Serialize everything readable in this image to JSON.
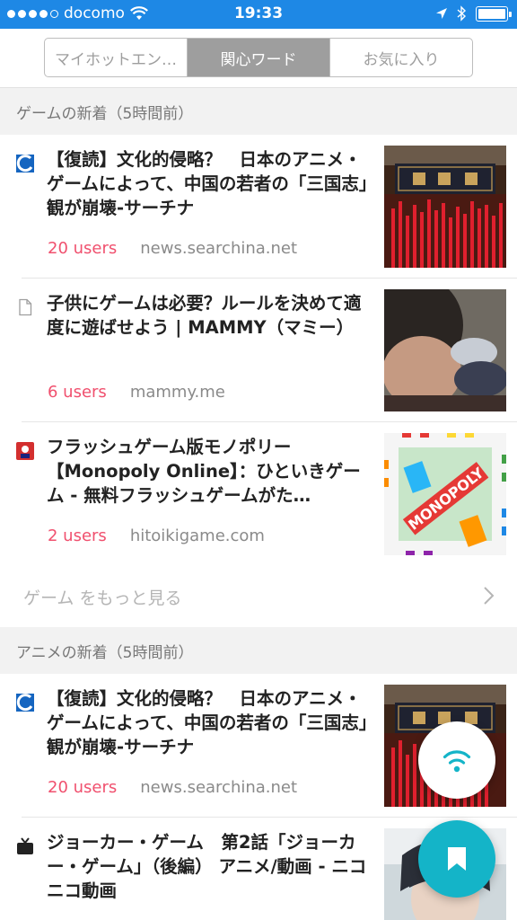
{
  "status_bar": {
    "carrier": "docomo",
    "time": "19:33",
    "signal_bars_filled": 4,
    "signal_bars_total": 5
  },
  "tabs": [
    {
      "label": "マイホットエン…",
      "active": false
    },
    {
      "label": "関心ワード",
      "active": true
    },
    {
      "label": "お気に入り",
      "active": false
    }
  ],
  "sections": [
    {
      "header": "ゲームの新着（5時間前）",
      "more_label": "ゲーム をもっと見る",
      "articles": [
        {
          "title": "【復読】文化的侵略？　日本のアニメ・ゲームによって、中国の若者の「三国志」観が崩壊-サーチナ",
          "users": "20 users",
          "domain": "news.searchina.net",
          "favicon": "searchina-icon",
          "thumbnail": "temple-incense-image"
        },
        {
          "title": "子供にゲームは必要？ルールを決めて適度に遊ばせよう | MAMMY（マミー）",
          "users": "6 users",
          "domain": "mammy.me",
          "favicon": "document-icon",
          "thumbnail": "child-playing-image"
        },
        {
          "title": "フラッシュゲーム版モノポリー【Monopoly Online】：ひといきゲーム - 無料フラッシュゲームがた…",
          "users": "2 users",
          "domain": "hitoikigame.com",
          "favicon": "hitoikigame-icon",
          "thumbnail": "monopoly-board-image",
          "thumbnail_text": "MONOPOLY"
        }
      ]
    },
    {
      "header": "アニメの新着（5時間前）",
      "articles": [
        {
          "title": "【復読】文化的侵略？　日本のアニメ・ゲームによって、中国の若者の「三国志」観が崩壊-サーチナ",
          "users": "20 users",
          "domain": "news.searchina.net",
          "favicon": "searchina-icon",
          "thumbnail": "temple-incense-image"
        },
        {
          "title": "ジョーカー・ゲーム　第2話「ジョーカー・ゲーム」（後編） アニメ/動画 - ニコニコ動画",
          "favicon": "niconico-icon",
          "thumbnail": "anime-character-image"
        }
      ]
    }
  ],
  "fabs": {
    "wifi": "wifi-icon",
    "bookmark": "bookmark-icon"
  },
  "colors": {
    "status_bar": "#1e88e5",
    "users_accent": "#f0506e",
    "bookmark_fab": "#14b4c8",
    "section_bg": "#f2f2f2"
  }
}
